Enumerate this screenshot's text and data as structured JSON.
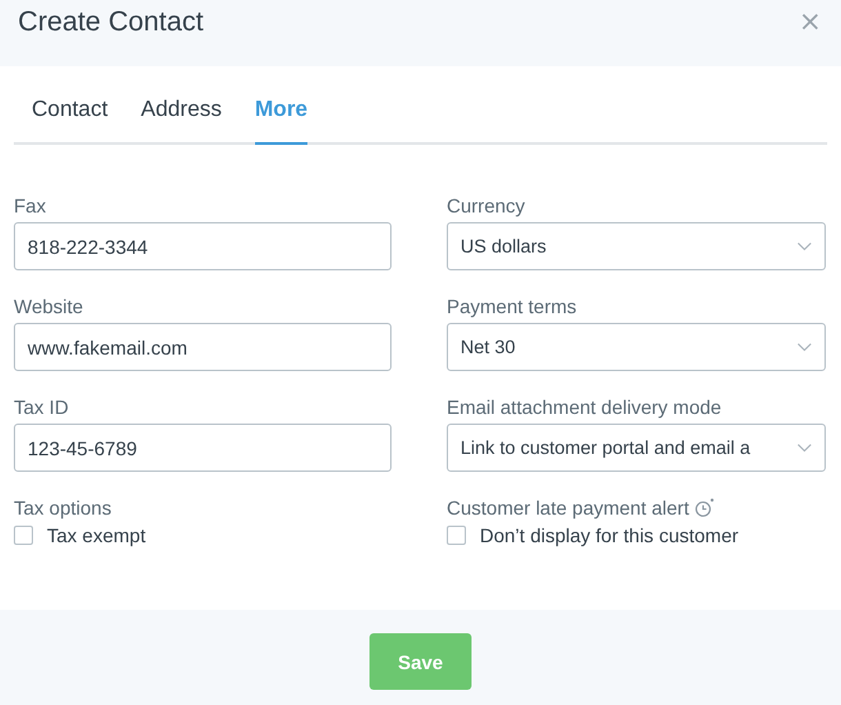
{
  "dialog": {
    "title": "Create Contact",
    "close": "×"
  },
  "tabs": [
    {
      "label": "Contact",
      "selected": false
    },
    {
      "label": "Address",
      "selected": false
    },
    {
      "label": "More",
      "selected": true
    }
  ],
  "fields": [
    {
      "kind": "text",
      "label": "Fax",
      "value": "818-222-3344"
    },
    {
      "kind": "select",
      "label": "Currency",
      "value": "US dollars"
    },
    {
      "kind": "text",
      "label": "Website",
      "value": "www.fakemail.com"
    },
    {
      "kind": "select",
      "label": "Payment terms",
      "value": "Net 30"
    },
    {
      "kind": "text",
      "label": "Tax ID",
      "value": "123-45-6789"
    },
    {
      "kind": "select",
      "label": "Email attachment delivery mode",
      "value": "Link to customer portal and email a"
    },
    {
      "kind": "checkbox",
      "label": "Tax options",
      "option": "Tax exempt",
      "checked": false
    },
    {
      "kind": "checkbox",
      "label": "Customer late payment alert",
      "info_icon": true,
      "option": "Don’t display for this customer",
      "checked": false
    }
  ],
  "buttons": [
    {
      "label": "Save"
    }
  ]
}
